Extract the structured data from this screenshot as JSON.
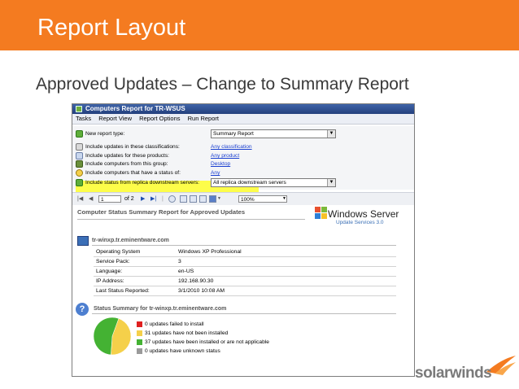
{
  "slide": {
    "title": "Report Layout",
    "subtitle": "Approved Updates – Change to Summary Report",
    "brand": "solarwinds"
  },
  "window": {
    "title": "Computers Report for TR-WSUS",
    "menu": [
      "Tasks",
      "Report View",
      "Report Options",
      "Run Report"
    ]
  },
  "options": {
    "report_type_label": "New report type:",
    "report_type_value": "Summary Report",
    "classifications_label": "Include updates in these classifications:",
    "classifications_link": "Any classification",
    "products_label": "Include updates for these products:",
    "products_link": "Any product",
    "group_label": "Include computers from this group:",
    "group_link": "Desktop",
    "status_label": "Include computers that have a status of:",
    "status_link": "Any",
    "replica_label": "Include status from replica downstream servers:",
    "replica_value": "All replica downstream servers"
  },
  "toolbar": {
    "page": "1",
    "of_pages": "of 2",
    "zoom": "100%"
  },
  "report": {
    "title": "Computer Status Summary Report for Approved Updates",
    "logo_word": "Windows Server",
    "logo_sub": "Update Services 3.0",
    "host": "tr-winxp.tr.eminentware.com",
    "rows": [
      {
        "k": "Operating System",
        "v": "Windows XP Professional"
      },
      {
        "k": "Service Pack:",
        "v": "3"
      },
      {
        "k": "Language:",
        "v": "en-US"
      },
      {
        "k": "IP Address:",
        "v": "192.168.90.30"
      },
      {
        "k": "Last Status Reported:",
        "v": "3/1/2010 10:08 AM"
      }
    ],
    "status_title": "Status Summary for tr-winxp.tr.eminentware.com",
    "legend": [
      {
        "text": "0 updates failed to install",
        "color": "#e02020",
        "count": 0
      },
      {
        "text": "31 updates have not been installed",
        "color": "#f5d04a",
        "count": 31
      },
      {
        "text": "37 updates have been installed or are not applicable",
        "color": "#44b233",
        "count": 37
      },
      {
        "text": "0 updates have unknown status",
        "color": "#9a9a9a",
        "count": 0
      }
    ]
  },
  "colors": {
    "banner": "#f47b20",
    "highlight": "#fdfd4a",
    "link": "#1a3fd0"
  }
}
